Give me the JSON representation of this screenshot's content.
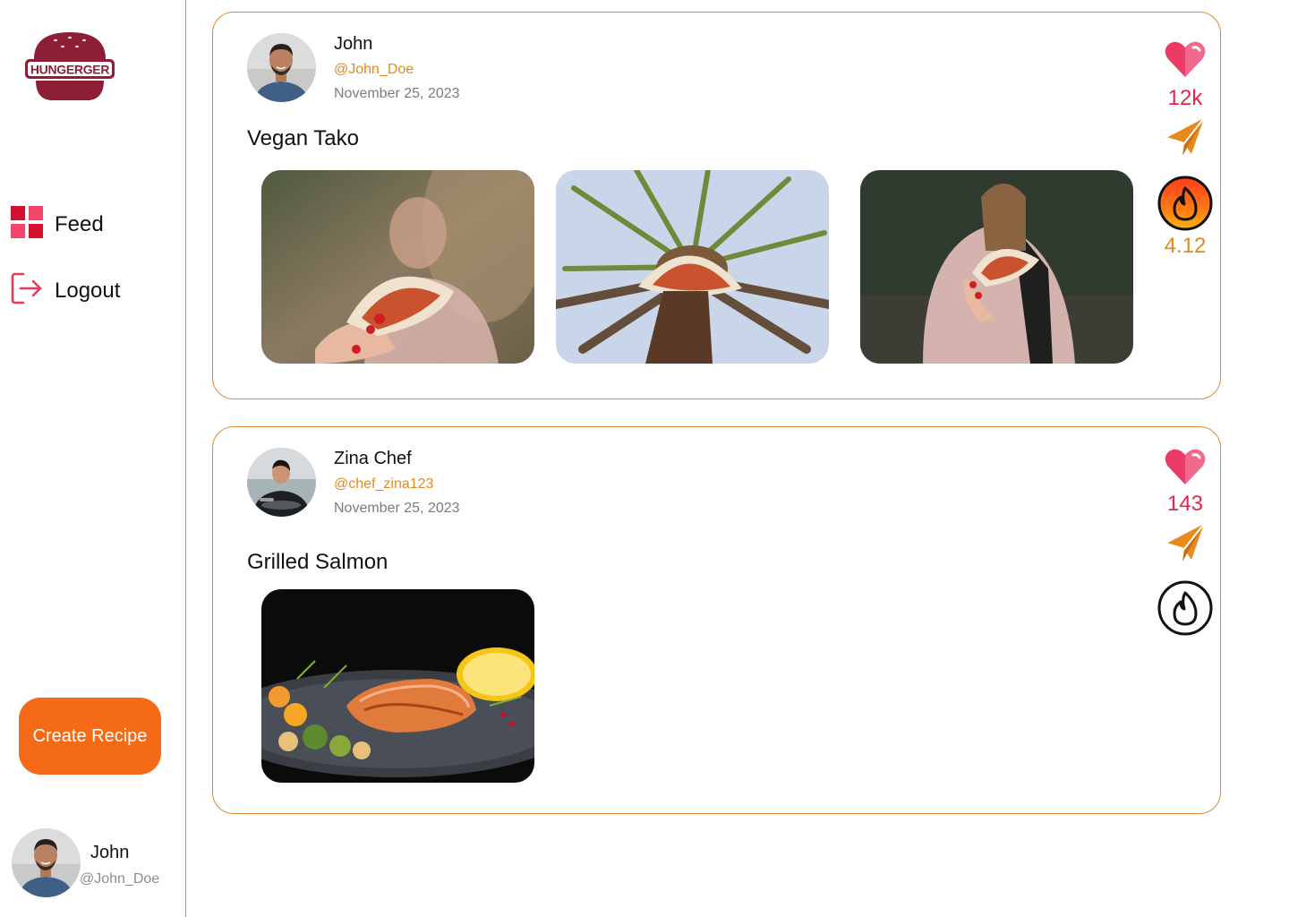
{
  "app": {
    "brand": "HUNGERGER",
    "brand_color": "#8c1f35",
    "accent": "#f56a17",
    "border_color": "#d98a3a"
  },
  "sidebar": {
    "nav": [
      {
        "label": "Feed",
        "icon": "grid-icon"
      },
      {
        "label": "Logout",
        "icon": "logout-icon"
      }
    ],
    "create_button": "Create Recipe",
    "profile": {
      "name": "John",
      "handle": "@John_Doe"
    }
  },
  "posts": [
    {
      "author": "John",
      "handle": "@John_Doe",
      "date": "November 25, 2023",
      "title": "Vegan Tako",
      "likes": "12k",
      "rating": "4.12",
      "images": [
        "taco-photo",
        "taco-photo",
        "taco-photo"
      ]
    },
    {
      "author": "Zina Chef",
      "handle": "@chef_zina123",
      "date": "November 25, 2023",
      "title": "Grilled Salmon",
      "likes": "143",
      "images": [
        "salmon-photo"
      ]
    }
  ]
}
